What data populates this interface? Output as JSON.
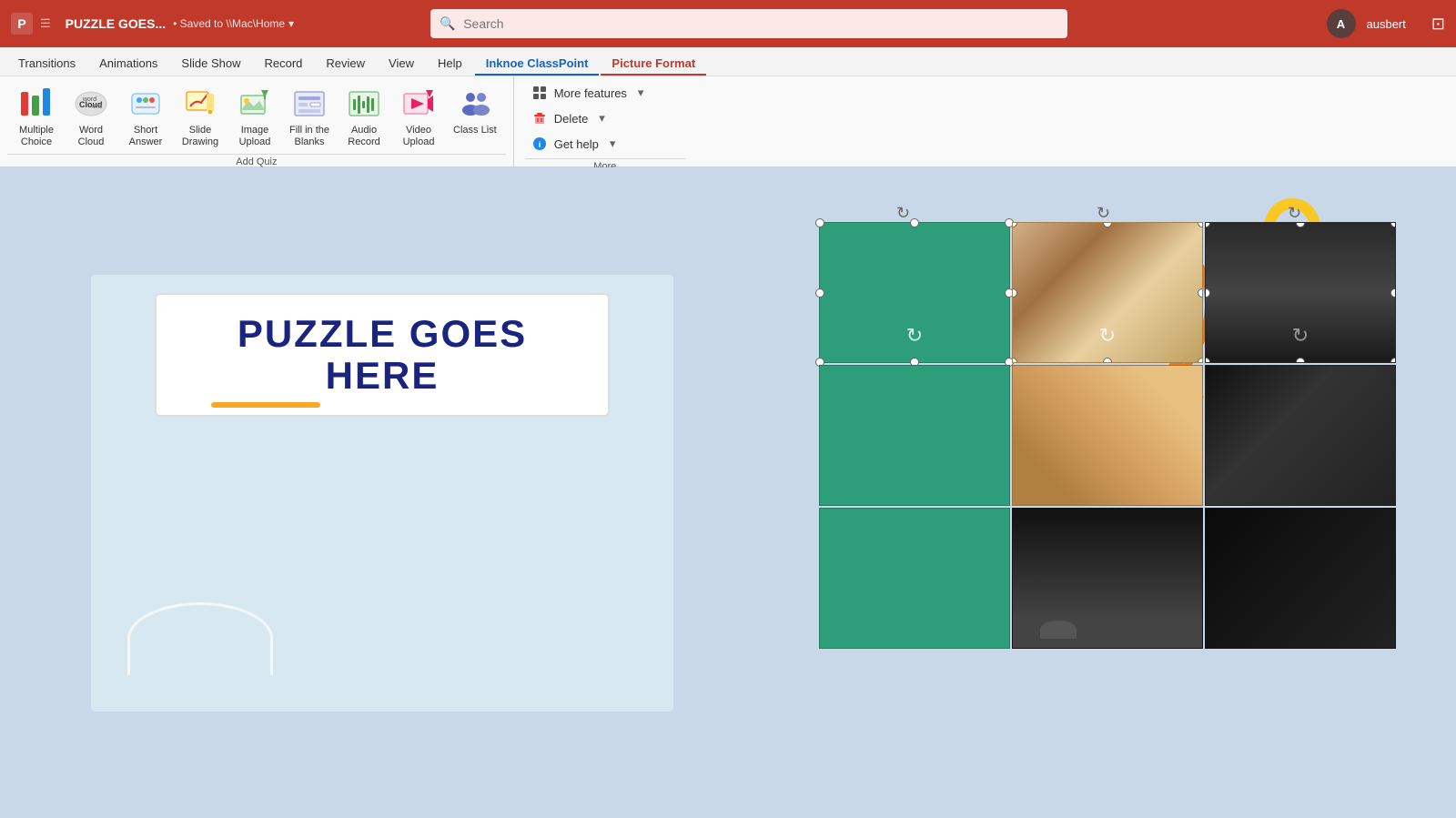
{
  "titlebar": {
    "app_icon": "P",
    "title": "PUZZLE GOES...",
    "saved_text": "• Saved to \\\\Mac\\Home",
    "saved_dropdown": "▾",
    "search_placeholder": "Search",
    "user_name": "ausbert",
    "user_initial": "A"
  },
  "ribbon_tabs": [
    {
      "label": "Transitions",
      "active": false
    },
    {
      "label": "Animations",
      "active": false
    },
    {
      "label": "Slide Show",
      "active": false
    },
    {
      "label": "Record",
      "active": false
    },
    {
      "label": "Review",
      "active": false
    },
    {
      "label": "View",
      "active": false
    },
    {
      "label": "Help",
      "active": false
    },
    {
      "label": "Inknoe ClassPoint",
      "active": true,
      "style": "classpoint"
    },
    {
      "label": "Picture Format",
      "active": true,
      "style": "red"
    }
  ],
  "ribbon": {
    "quiz_section_label": "Add Quiz",
    "more_section_label": "More",
    "buttons": [
      {
        "id": "multiple-choice",
        "label": "Multiple\nChoice",
        "icon": "mc"
      },
      {
        "id": "word-cloud",
        "label": "Word\nCloud",
        "icon": "wc"
      },
      {
        "id": "short-answer",
        "label": "Short\nAnswer",
        "icon": "sa"
      },
      {
        "id": "slide-drawing",
        "label": "Slide\nDrawing",
        "icon": "sd"
      },
      {
        "id": "image-upload",
        "label": "Image\nUpload",
        "icon": "iu"
      },
      {
        "id": "fill-blanks",
        "label": "Fill in the\nBlanks",
        "icon": "fb"
      },
      {
        "id": "audio-record",
        "label": "Audio\nRecord",
        "icon": "ar"
      },
      {
        "id": "video-upload",
        "label": "Video\nUpload",
        "icon": "vu"
      },
      {
        "id": "class-list",
        "label": "Class List",
        "icon": "cl"
      }
    ],
    "more_items": [
      {
        "id": "more-features",
        "label": "More features",
        "icon": "grid"
      },
      {
        "id": "delete",
        "label": "Delete",
        "icon": "trash"
      },
      {
        "id": "get-help",
        "label": "Get help",
        "icon": "info"
      }
    ]
  },
  "slide": {
    "title_line1": "PUZZLE GOES",
    "title_line2": "HERE"
  },
  "colors": {
    "red_accent": "#C0392B",
    "classpoint_blue": "#1565C0",
    "teal_puzzle": "#2e9e7a",
    "handbag_blue": "#1a3a7a",
    "handbag_yellow": "#f9c825"
  }
}
